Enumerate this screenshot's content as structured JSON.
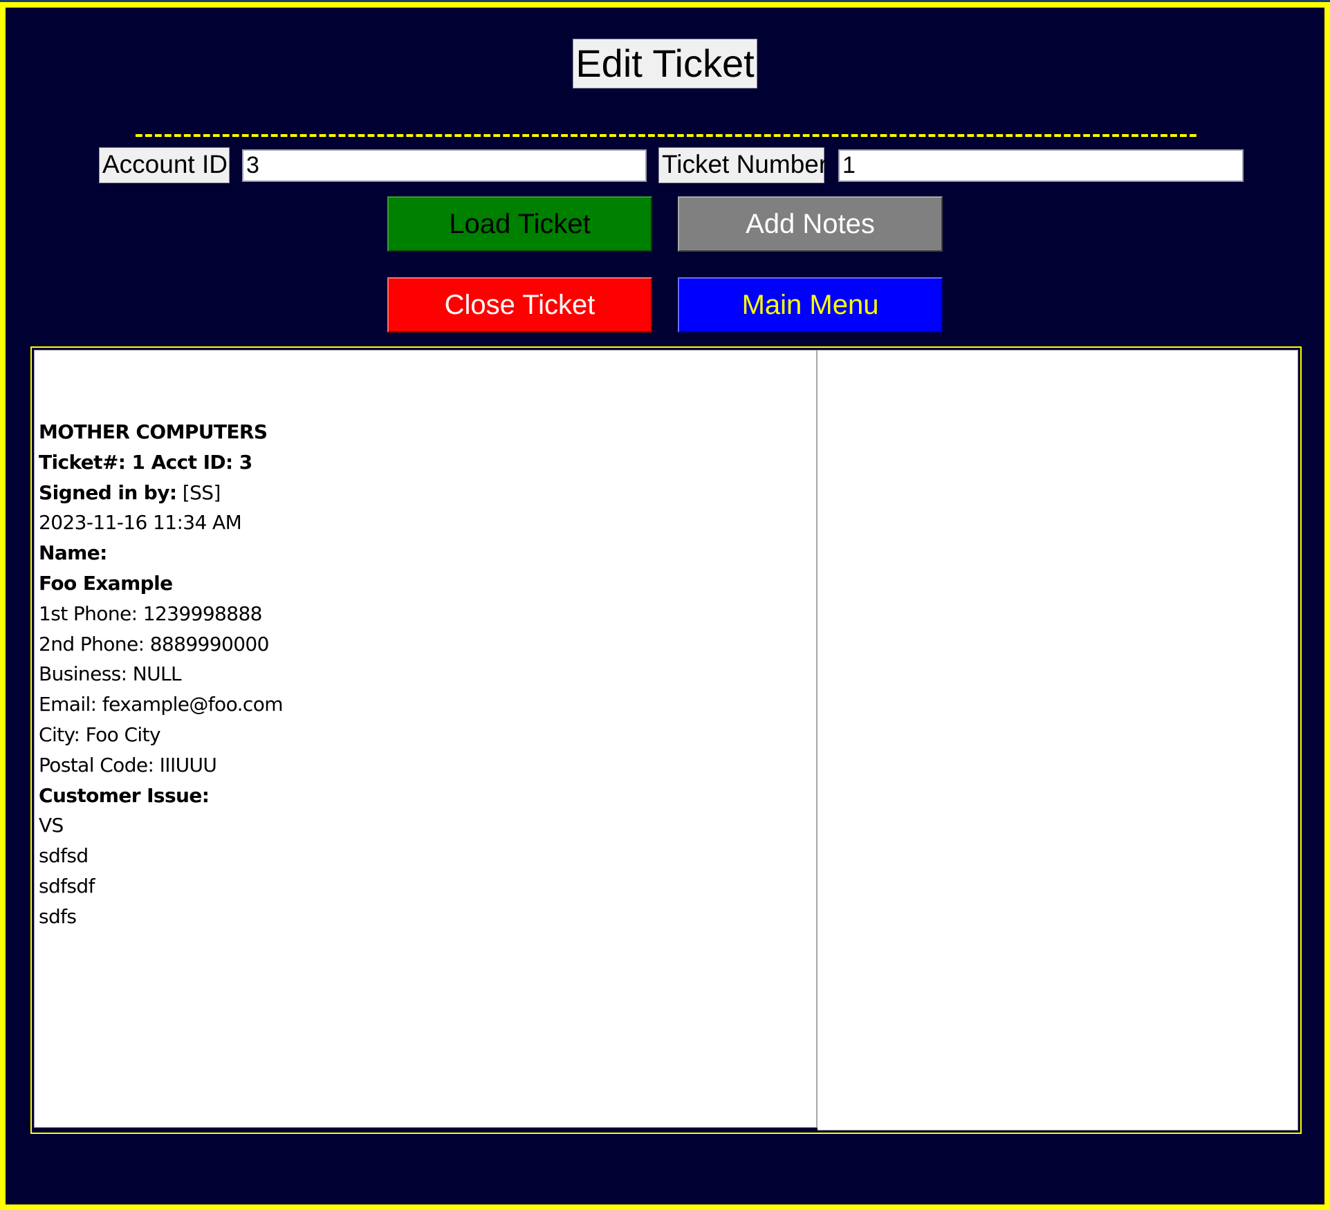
{
  "header": {
    "title": "Edit Ticket",
    "separator": "--------------------------------------------------------------------------------------------------------------"
  },
  "fields": {
    "account_id": {
      "label": "Account ID",
      "value": "3"
    },
    "ticket_number": {
      "label": "Ticket Number",
      "value": "1"
    }
  },
  "buttons": {
    "load_ticket": "Load Ticket",
    "add_notes": "Add Notes",
    "close_ticket": "Close Ticket",
    "main_menu": "Main Menu"
  },
  "ticket": {
    "company": "MOTHER COMPUTERS",
    "ticket_line": "Ticket#: 1 Acct ID: 3",
    "signed_in_label": "Signed in by:",
    "signed_in_value": " [SS]",
    "datetime": "2023-11-16 11:34 AM",
    "name_label": "Name:",
    "name_value": "Foo Example",
    "phone1": "1st Phone: 1239998888",
    "phone2": "2nd Phone: 8889990000",
    "business": "Business: NULL",
    "email": "Email: fexample@foo.com",
    "city": "City: Foo City",
    "postal_code": "Postal Code: IIIUUU",
    "issue_label": "Customer Issue:",
    "issue_lines": [
      "VS",
      "sdfsd",
      "sdfsdf",
      "sdfs"
    ]
  },
  "notes": {
    "content": ""
  },
  "colors": {
    "background": "#000033",
    "frame_border": "#ffff00",
    "load_button": "#008000",
    "add_notes_button": "#808080",
    "close_button": "#ff0000",
    "main_menu_button": "#0000ff",
    "main_menu_text": "#ffff00"
  }
}
